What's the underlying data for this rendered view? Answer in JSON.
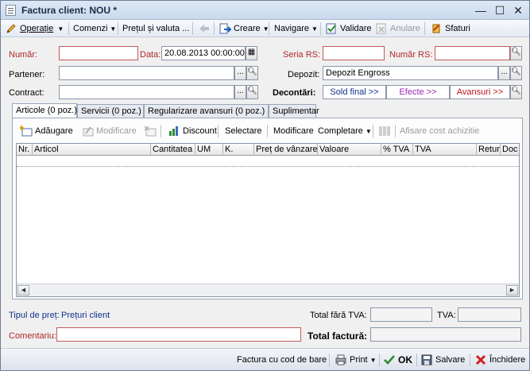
{
  "window": {
    "title": "Factura client: NOU *",
    "controls": {
      "minimize": "—",
      "maximize": "☐",
      "close": "✕"
    }
  },
  "toolbar": {
    "operatie": "Operație",
    "comenzi": "Comenzi",
    "pret_valuta": "Prețul și valuta ...",
    "creare": "Creare",
    "navigare": "Navigare",
    "validare": "Validare",
    "anulare": "Anulare",
    "sfaturi": "Sfaturi"
  },
  "header": {
    "numar_label": "Număr:",
    "numar_value": "",
    "data_label": "Data:",
    "data_value": "20.08.2013 00:00:00",
    "seria_rs_label": "Seria RS:",
    "seria_rs_value": "",
    "numar_rs_label": "Număr RS:",
    "numar_rs_value": "",
    "partener_label": "Partener:",
    "partener_value": "",
    "depozit_label": "Depozit:",
    "depozit_value": "Depozit Engross",
    "contract_label": "Contract:",
    "contract_value": "",
    "decontari_label": "Decontări:",
    "sold_final": "Sold final >>",
    "efecte": "Efecte >>",
    "avansuri": "Avansuri >>"
  },
  "tabs": [
    "Articole (0 poz.)",
    "Servicii (0 poz.)",
    "Regularizare avansuri (0 poz.)",
    "Suplimentar"
  ],
  "grid_toolbar": {
    "adaugare": "Adăugare",
    "modificare_dis": "Modificare",
    "discount": "Discount",
    "selectare": "Selectare",
    "modificare": "Modificare",
    "completare": "Completare",
    "afisare_cost": "Afisare cost achizitie"
  },
  "grid": {
    "columns": [
      "Nr.",
      "Articol",
      "Cantitatea",
      "UM",
      "K.",
      "Preț de vânzare",
      "Valoare",
      "% TVA",
      "TVA",
      "Retur",
      "Doc"
    ],
    "rows": []
  },
  "footer": {
    "tip_pret_label": "Tipul de preț:",
    "tip_pret_value": "Prețuri client",
    "total_fara_tva_label": "Total fără TVA:",
    "total_fara_tva_value": "",
    "tva_label": "TVA:",
    "tva_value": "",
    "comentariu_label": "Comentariu:",
    "comentariu_value": "",
    "total_factura_label": "Total factură:",
    "total_factura_value": ""
  },
  "statusbar": {
    "cod_bare": "Factura cu cod de bare",
    "print": "Print",
    "ok": "OK",
    "salvare": "Salvare",
    "inchidere": "Închidere"
  },
  "colors": {
    "required_label": "#b0282a",
    "sold_final": "#13308f",
    "efecte": "#9b27b0",
    "avansuri": "#c0141c",
    "ok_green": "#2e8b2e"
  }
}
